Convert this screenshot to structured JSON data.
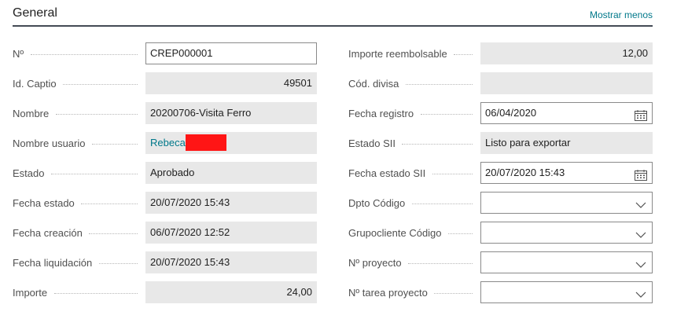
{
  "section": {
    "title": "General",
    "toggle_label": "Mostrar menos"
  },
  "left": [
    {
      "name": "no",
      "label": "Nº",
      "value": "CREP000001",
      "kind": "editable"
    },
    {
      "name": "id-captio",
      "label": "Id. Captio",
      "value": "49501",
      "kind": "readonly-right"
    },
    {
      "name": "nombre",
      "label": "Nombre",
      "value": "20200706-Visita Ferro",
      "kind": "readonly"
    },
    {
      "name": "nombre-usuario",
      "label": "Nombre usuario",
      "value": "Rebeca",
      "kind": "link"
    },
    {
      "name": "estado",
      "label": "Estado",
      "value": "Aprobado",
      "kind": "readonly"
    },
    {
      "name": "fecha-estado",
      "label": "Fecha estado",
      "value": "20/07/2020 15:43",
      "kind": "readonly"
    },
    {
      "name": "fecha-creacion",
      "label": "Fecha creación",
      "value": "06/07/2020 12:52",
      "kind": "readonly"
    },
    {
      "name": "fecha-liquidacion",
      "label": "Fecha liquidación",
      "value": "20/07/2020 15:43",
      "kind": "readonly"
    },
    {
      "name": "importe",
      "label": "Importe",
      "value": "24,00",
      "kind": "readonly-right"
    }
  ],
  "right": [
    {
      "name": "importe-reembolsable",
      "label": "Importe reembolsable",
      "value": "12,00",
      "kind": "readonly-right"
    },
    {
      "name": "cod-divisa",
      "label": "Cód. divisa",
      "value": "",
      "kind": "readonly"
    },
    {
      "name": "fecha-registro",
      "label": "Fecha registro",
      "value": "06/04/2020",
      "kind": "date"
    },
    {
      "name": "estado-sii",
      "label": "Estado SII",
      "value": "Listo para exportar",
      "kind": "readonly"
    },
    {
      "name": "fecha-estado-sii",
      "label": "Fecha estado SII",
      "value": "20/07/2020 15:43",
      "kind": "date"
    },
    {
      "name": "dpto-codigo",
      "label": "Dpto Código",
      "value": "",
      "kind": "dropdown"
    },
    {
      "name": "grupocliente-codigo",
      "label": "Grupocliente Código",
      "value": "",
      "kind": "dropdown"
    },
    {
      "name": "no-proyecto",
      "label": "Nº proyecto",
      "value": "",
      "kind": "dropdown"
    },
    {
      "name": "no-tarea-proyecto",
      "label": "Nº tarea proyecto",
      "value": "",
      "kind": "dropdown"
    }
  ]
}
